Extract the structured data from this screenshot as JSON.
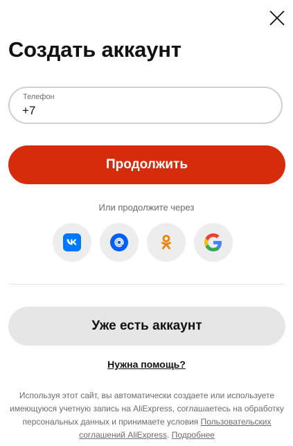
{
  "header": {
    "title": "Создать аккаунт",
    "close_icon": "close-icon"
  },
  "phone_field": {
    "label": "Телефон",
    "value": "+7"
  },
  "continue_button": "Продолжить",
  "social": {
    "prompt": "Или продолжите через",
    "providers": [
      {
        "name": "vk",
        "icon": "vk-icon",
        "color": "#0077ff"
      },
      {
        "name": "mail",
        "icon": "mail-icon",
        "color": "#005ff9"
      },
      {
        "name": "ok",
        "icon": "ok-icon",
        "color": "#ee8208"
      },
      {
        "name": "google",
        "icon": "google-icon",
        "colors": [
          "#4285f4",
          "#34a853",
          "#fbbc05",
          "#ea4335"
        ]
      }
    ]
  },
  "login_button": "Уже есть аккаунт",
  "help_link": "Нужна помощь?",
  "legal": {
    "text": "Используя этот сайт, вы автоматически создаете или используете имеющуюся учетную запись на AliExpress, соглашаетесь на обработку персональных данных и принимаете условия",
    "terms_link": "Пользовательских соглашений AliExpress",
    "separator": ".",
    "more_link": "Подробнее"
  },
  "colors": {
    "accent": "#d62c0b",
    "secondary_button": "#e6e6e6",
    "social_bg": "#ededed",
    "muted_text": "#6b6b6b"
  }
}
